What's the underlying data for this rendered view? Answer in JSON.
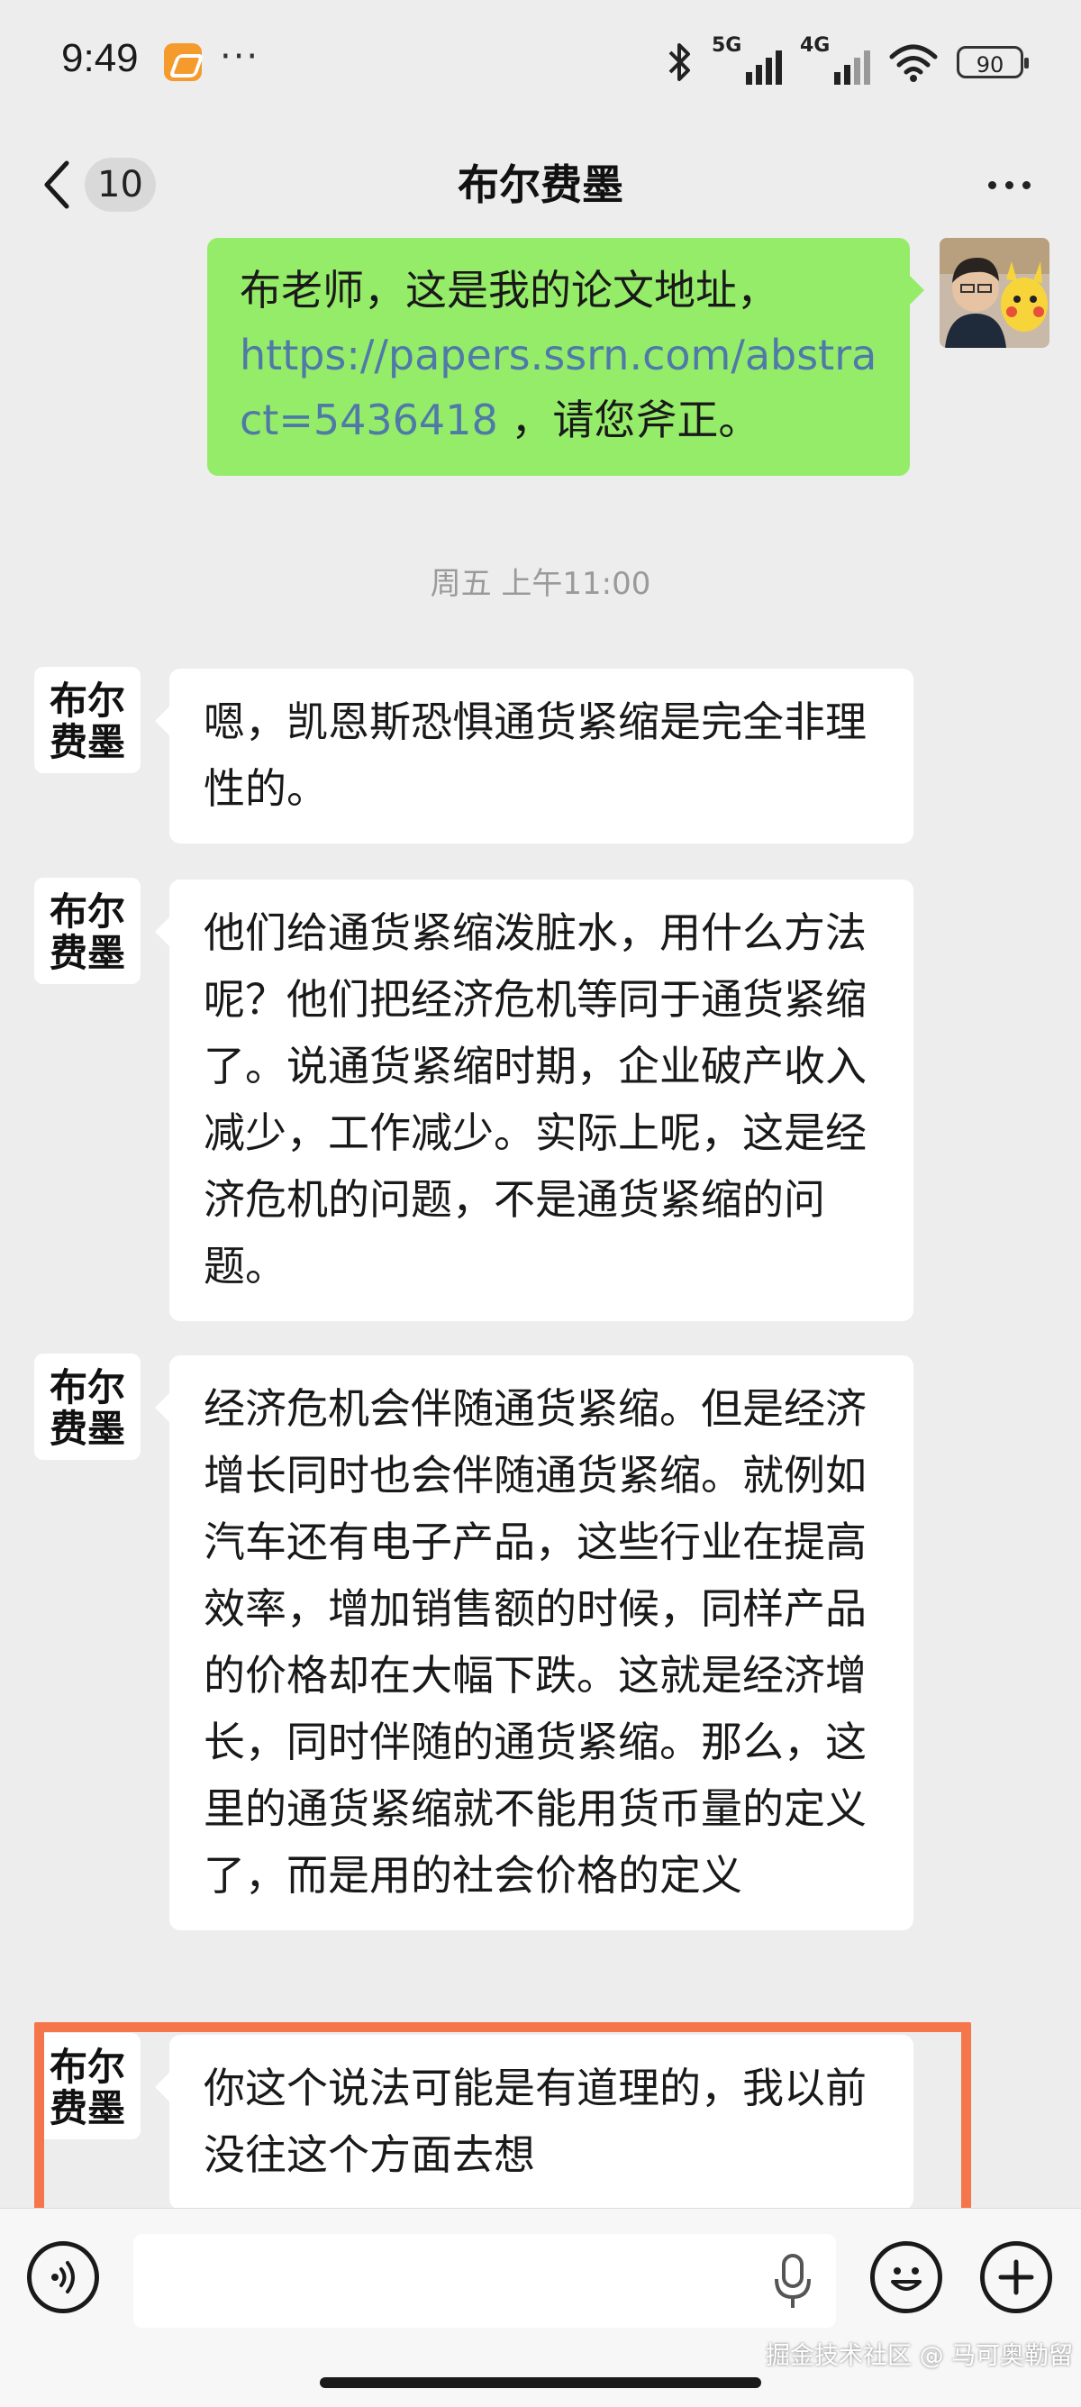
{
  "status_bar": {
    "time": "9:49",
    "more": "···",
    "signal1_label": "5G",
    "signal2_label": "4G",
    "battery": "90"
  },
  "nav": {
    "back_count": "10",
    "title": "布尔费墨"
  },
  "self_message": {
    "text_before": "布老师，这是我的论文地址，",
    "link": "https://papers.ssrn.com/abstract=5436418",
    "text_after": " ，请您斧正。"
  },
  "timestamp": "周五 上午11:00",
  "contact": {
    "avatar_text_line1": "布尔",
    "avatar_text_line2": "费墨"
  },
  "messages": [
    {
      "text": "嗯，凯恩斯恐惧通货紧缩是完全非理性的。"
    },
    {
      "text": "他们给通货紧缩泼脏水，用什么方法呢？他们把经济危机等同于通货紧缩了。说通货紧缩时期，企业破产收入减少，工作减少。实际上呢，这是经济危机的问题，不是通货紧缩的问题。"
    },
    {
      "text": "经济危机会伴随通货紧缩。但是经济增长同时也会伴随通货紧缩。就例如汽车还有电子产品，这些行业在提高效率，增加销售额的时候，同样产品的价格却在大幅下跌。这就是经济增长，同时伴随的通货紧缩。那么，这里的通货紧缩就不能用货币量的定义了，而是用的社会价格的定义"
    },
    {
      "text": "你这个说法可能是有道理的，我以前没往这个方面去想"
    }
  ],
  "input": {
    "value": "",
    "placeholder": ""
  },
  "watermark": "掘金技术社区 @ 马可奥勒留",
  "colors": {
    "self_bubble": "#95ec69",
    "link": "#4f7aa8",
    "highlight": "#f6764b",
    "background": "#ededed"
  }
}
